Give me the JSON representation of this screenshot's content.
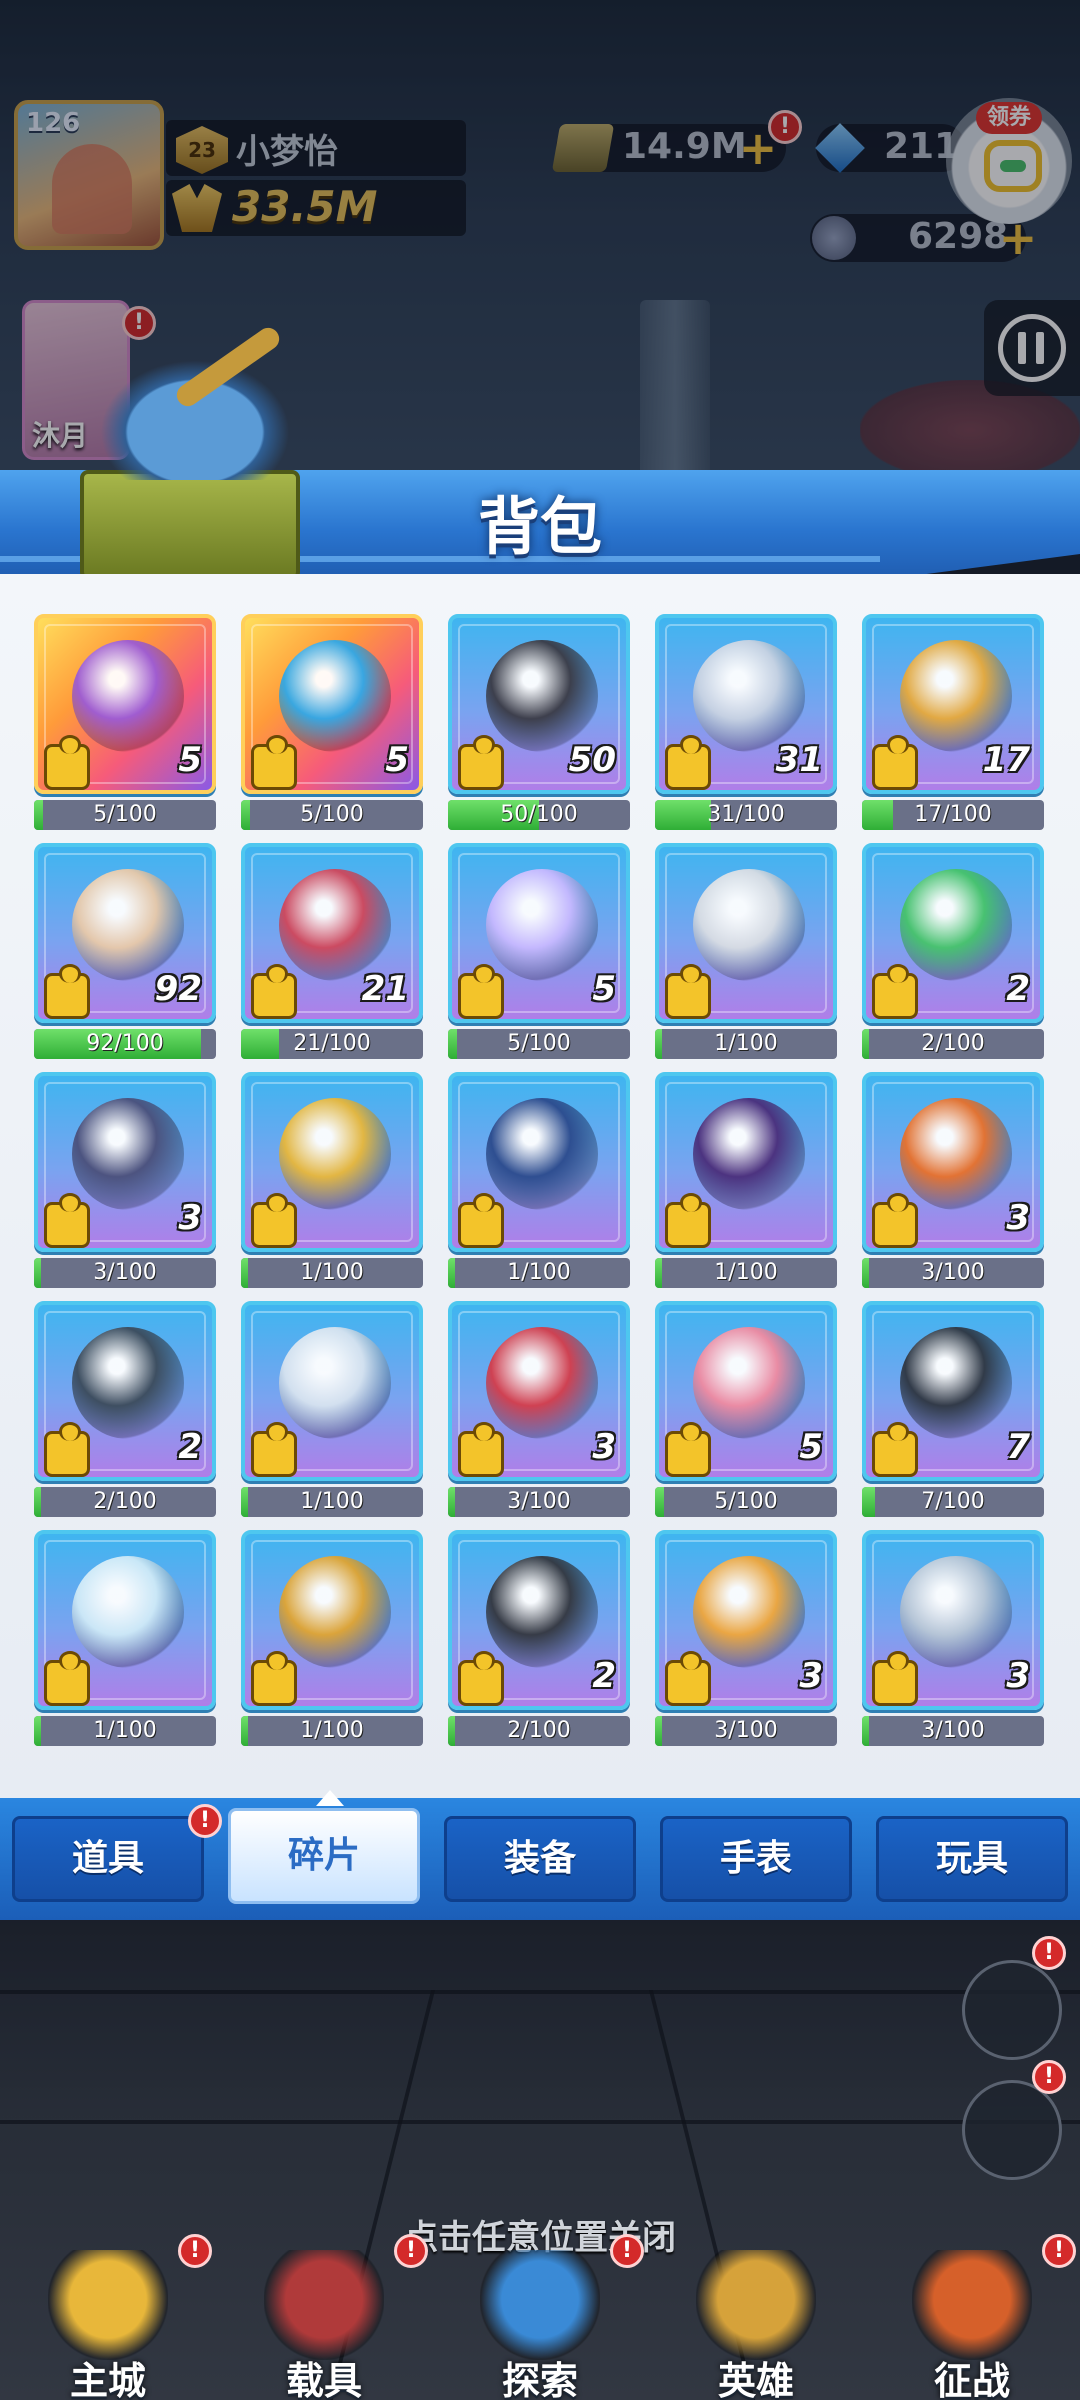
{
  "player": {
    "level": "126",
    "rank": "23",
    "name": "小梦怡",
    "power": "33.5M"
  },
  "currencies": {
    "cash": "14.9M",
    "gems": "2110",
    "tokens": "6298"
  },
  "coupon": {
    "label": "领券"
  },
  "hero": {
    "name": "沐月"
  },
  "panel": {
    "title": "背包"
  },
  "items": [
    {
      "qty": "5",
      "progress": "5/100",
      "fill": 0.05,
      "rarity": "orange",
      "icon": "circuit-crate-icon",
      "color": "#9b5bd6"
    },
    {
      "qty": "5",
      "progress": "5/100",
      "fill": 0.05,
      "rarity": "orange",
      "icon": "blue-watch-icon",
      "color": "#2fa8e8"
    },
    {
      "qty": "50",
      "progress": "50/100",
      "fill": 0.5,
      "rarity": "blue",
      "icon": "lightning-shield-watch-icon",
      "color": "#3a3a44"
    },
    {
      "qty": "31",
      "progress": "31/100",
      "fill": 0.31,
      "rarity": "blue",
      "icon": "crystal-collar-icon",
      "color": "#c9d3e2"
    },
    {
      "qty": "17",
      "progress": "17/100",
      "fill": 0.17,
      "rarity": "blue",
      "icon": "golden-fist-trophy-icon",
      "color": "#e7a93a"
    },
    {
      "qty": "92",
      "progress": "92/100",
      "fill": 0.92,
      "rarity": "blue",
      "icon": "orb-shell-icon",
      "color": "#e9c9a8"
    },
    {
      "qty": "21",
      "progress": "21/100",
      "fill": 0.21,
      "rarity": "blue",
      "icon": "red-eye-capsule-icon",
      "color": "#d0465a"
    },
    {
      "qty": "5",
      "progress": "5/100",
      "fill": 0.05,
      "rarity": "blue",
      "icon": "crystal-sphere-icon",
      "color": "#c8b9ff"
    },
    {
      "qty": "",
      "progress": "1/100",
      "fill": 0.01,
      "rarity": "blue",
      "icon": "control-console-icon",
      "color": "#d9dde3"
    },
    {
      "qty": "2",
      "progress": "2/100",
      "fill": 0.02,
      "rarity": "blue",
      "icon": "green-blade-icon",
      "color": "#46c36a"
    },
    {
      "qty": "3",
      "progress": "3/100",
      "fill": 0.03,
      "rarity": "blue",
      "icon": "dark-gem-coffin-icon",
      "color": "#4a4f7a"
    },
    {
      "qty": "",
      "progress": "1/100",
      "fill": 0.01,
      "rarity": "blue",
      "icon": "winged-helmet-icon",
      "color": "#e8b73a"
    },
    {
      "qty": "",
      "progress": "1/100",
      "fill": 0.01,
      "rarity": "blue",
      "icon": "eye-bot-icon",
      "color": "#2b4a8c"
    },
    {
      "qty": "",
      "progress": "1/100",
      "fill": 0.01,
      "rarity": "blue",
      "icon": "purple-bird-icon",
      "color": "#4a2d7a"
    },
    {
      "qty": "3",
      "progress": "3/100",
      "fill": 0.03,
      "rarity": "blue",
      "icon": "fire-staff-icon",
      "color": "#e8702a"
    },
    {
      "qty": "2",
      "progress": "2/100",
      "fill": 0.02,
      "rarity": "blue",
      "icon": "cannon-barrel-icon",
      "color": "#3b4a5a"
    },
    {
      "qty": "",
      "progress": "1/100",
      "fill": 0.01,
      "rarity": "blue",
      "icon": "silver-swirl-icon",
      "color": "#d7e3ef"
    },
    {
      "qty": "3",
      "progress": "3/100",
      "fill": 0.03,
      "rarity": "blue",
      "icon": "thunder-wing-icon",
      "color": "#d43c4a"
    },
    {
      "qty": "5",
      "progress": "5/100",
      "fill": 0.05,
      "rarity": "blue",
      "icon": "shark-trident-icon",
      "color": "#f08aa0"
    },
    {
      "qty": "7",
      "progress": "7/100",
      "fill": 0.07,
      "rarity": "blue",
      "icon": "claw-hook-icon",
      "color": "#2e3540"
    },
    {
      "qty": "",
      "progress": "1/100",
      "fill": 0.01,
      "rarity": "blue",
      "icon": "ice-crystal-icon",
      "color": "#cfeaf7"
    },
    {
      "qty": "",
      "progress": "1/100",
      "fill": 0.01,
      "rarity": "blue",
      "icon": "golden-ring-icon",
      "color": "#e0a431"
    },
    {
      "qty": "2",
      "progress": "2/100",
      "fill": 0.02,
      "rarity": "blue",
      "icon": "black-cannon-icon",
      "color": "#33363e"
    },
    {
      "qty": "3",
      "progress": "3/100",
      "fill": 0.03,
      "rarity": "blue",
      "icon": "golden-ankh-icon",
      "color": "#f0a63a"
    },
    {
      "qty": "3",
      "progress": "3/100",
      "fill": 0.03,
      "rarity": "blue",
      "icon": "silver-blade-icon",
      "color": "#b9c7d6"
    }
  ],
  "tabs": [
    {
      "label": "道具",
      "active": false,
      "alert": true
    },
    {
      "label": "碎片",
      "active": true,
      "alert": false
    },
    {
      "label": "装备",
      "active": false,
      "alert": false
    },
    {
      "label": "手表",
      "active": false,
      "alert": false
    },
    {
      "label": "玩具",
      "active": false,
      "alert": false
    }
  ],
  "close_hint": "点击任意位置关闭",
  "nav": [
    {
      "label": "主城",
      "icon": "castle-icon",
      "color": "#e8b73a"
    },
    {
      "label": "载具",
      "icon": "vehicle-icon",
      "color": "#b03a3a"
    },
    {
      "label": "探索",
      "icon": "globe-icon",
      "color": "#3a8ad6"
    },
    {
      "label": "英雄",
      "icon": "hero-helmet-icon",
      "color": "#d6a23a"
    },
    {
      "label": "征战",
      "icon": "battle-screen-icon",
      "color": "#d6602a"
    }
  ]
}
